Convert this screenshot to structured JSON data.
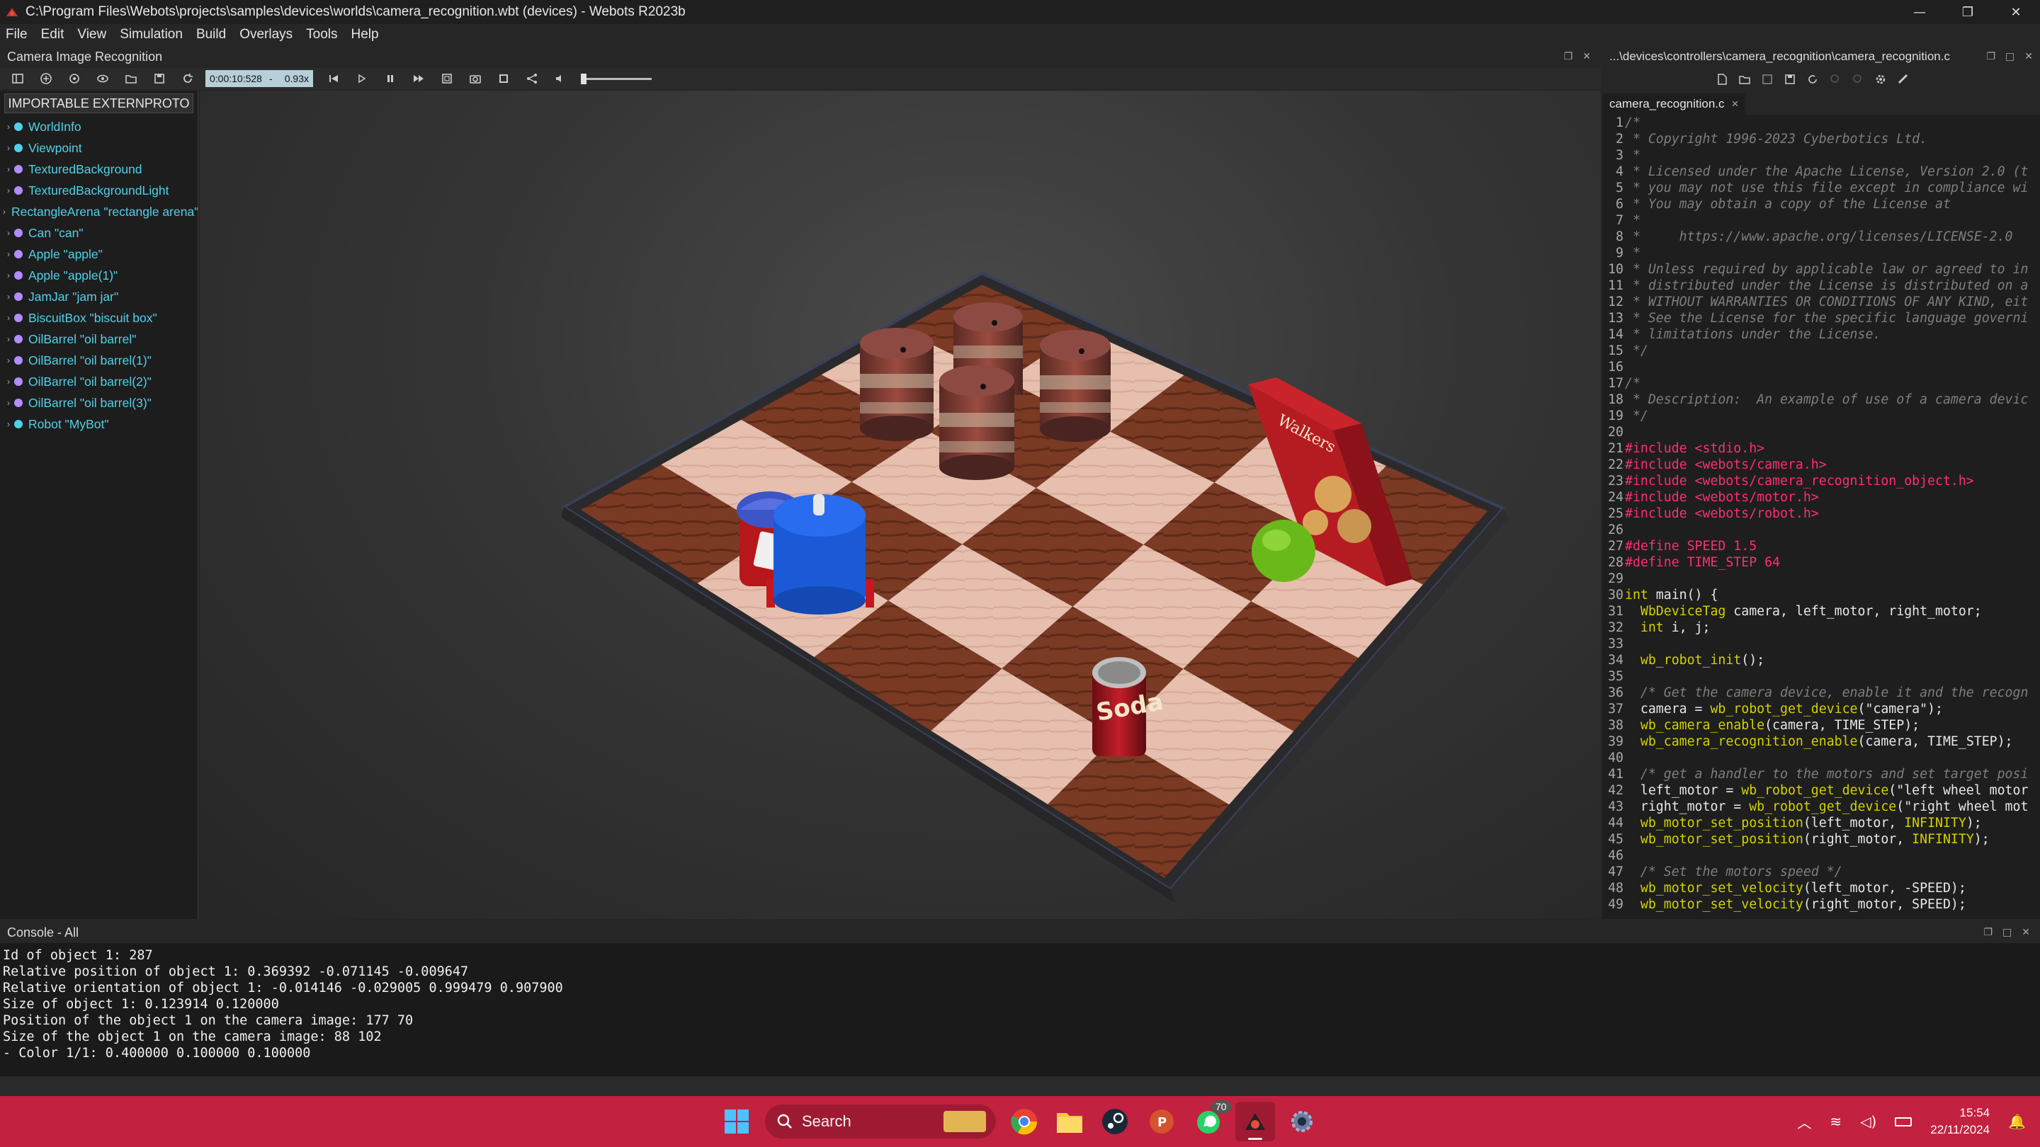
{
  "window": {
    "title": "C:\\Program Files\\Webots\\projects\\samples\\devices\\worlds\\camera_recognition.wbt (devices) - Webots R2023b",
    "minimize": "—",
    "maximize": "❐",
    "close": "✕"
  },
  "menu": [
    "File",
    "Edit",
    "View",
    "Simulation",
    "Build",
    "Overlays",
    "Tools",
    "Help"
  ],
  "view_panel": {
    "title": "Camera Image Recognition"
  },
  "toolbar": {
    "time": "0:00:10:528",
    "separator": "-",
    "speed": "0.93x"
  },
  "scene_tree": {
    "externproto_label": "IMPORTABLE EXTERNPROTO",
    "items": [
      {
        "label": "WorldInfo",
        "color": "#4fd1e8"
      },
      {
        "label": "Viewpoint",
        "color": "#4fd1e8"
      },
      {
        "label": "TexturedBackground",
        "color": "#b38cff"
      },
      {
        "label": "TexturedBackgroundLight",
        "color": "#b38cff"
      },
      {
        "label": "RectangleArena \"rectangle arena\"",
        "color": "#b38cff"
      },
      {
        "label": "Can \"can\"",
        "color": "#b38cff"
      },
      {
        "label": "Apple \"apple\"",
        "color": "#b38cff"
      },
      {
        "label": "Apple \"apple(1)\"",
        "color": "#b38cff"
      },
      {
        "label": "JamJar \"jam jar\"",
        "color": "#b38cff"
      },
      {
        "label": "BiscuitBox \"biscuit box\"",
        "color": "#b38cff"
      },
      {
        "label": "OilBarrel \"oil barrel\"",
        "color": "#b38cff"
      },
      {
        "label": "OilBarrel \"oil barrel(1)\"",
        "color": "#b38cff"
      },
      {
        "label": "OilBarrel \"oil barrel(2)\"",
        "color": "#b38cff"
      },
      {
        "label": "OilBarrel \"oil barrel(3)\"",
        "color": "#b38cff"
      },
      {
        "label": "Robot \"MyBot\"",
        "color": "#4fd1e8"
      }
    ]
  },
  "scene_labels": {
    "can_text": "Soda",
    "box_brand": "Walkers"
  },
  "editor": {
    "path": "...\\devices\\controllers\\camera_recognition\\camera_recognition.c",
    "tab": "camera_recognition.c",
    "tab_close": "×",
    "lines": [
      {
        "n": "1",
        "html": "<span class='c-comment'>/*</span>"
      },
      {
        "n": "2",
        "html": "<span class='c-comment'> * Copyright 1996-2023 Cyberbotics Ltd.</span>"
      },
      {
        "n": "3",
        "html": "<span class='c-comment'> *</span>"
      },
      {
        "n": "4",
        "html": "<span class='c-comment'> * Licensed under the Apache License, Version 2.0 (t</span>"
      },
      {
        "n": "5",
        "html": "<span class='c-comment'> * you may not use this file except in compliance wi</span>"
      },
      {
        "n": "6",
        "html": "<span class='c-comment'> * You may obtain a copy of the License at</span>"
      },
      {
        "n": "7",
        "html": "<span class='c-comment'> *</span>"
      },
      {
        "n": "8",
        "html": "<span class='c-comment'> *     https://www.apache.org/licenses/LICENSE-2.0</span>"
      },
      {
        "n": "9",
        "html": "<span class='c-comment'> *</span>"
      },
      {
        "n": "10",
        "html": "<span class='c-comment'> * Unless required by applicable law or agreed to in</span>"
      },
      {
        "n": "11",
        "html": "<span class='c-comment'> * distributed under the License is distributed on a</span>"
      },
      {
        "n": "12",
        "html": "<span class='c-comment'> * WITHOUT WARRANTIES OR CONDITIONS OF ANY KIND, eit</span>"
      },
      {
        "n": "13",
        "html": "<span class='c-comment'> * See the License for the specific language governi</span>"
      },
      {
        "n": "14",
        "html": "<span class='c-comment'> * limitations under the License.</span>"
      },
      {
        "n": "15",
        "html": "<span class='c-comment'> */</span>"
      },
      {
        "n": "16",
        "html": ""
      },
      {
        "n": "17",
        "html": "<span class='c-comment'>/*</span>"
      },
      {
        "n": "18",
        "html": "<span class='c-comment'> * Description:  An example of use of a camera devic</span>"
      },
      {
        "n": "19",
        "html": "<span class='c-comment'> */</span>"
      },
      {
        "n": "20",
        "html": ""
      },
      {
        "n": "21",
        "html": "<span class='c-pre'>#include &lt;stdio.h&gt;</span>"
      },
      {
        "n": "22",
        "html": "<span class='c-pre'>#include &lt;webots/camera.h&gt;</span>"
      },
      {
        "n": "23",
        "html": "<span class='c-pre'>#include &lt;webots/camera_recognition_object.h&gt;</span>"
      },
      {
        "n": "24",
        "html": "<span class='c-pre'>#include &lt;webots/motor.h&gt;</span>"
      },
      {
        "n": "25",
        "html": "<span class='c-pre'>#include &lt;webots/robot.h&gt;</span>"
      },
      {
        "n": "26",
        "html": ""
      },
      {
        "n": "27",
        "html": "<span class='c-pre'>#define SPEED 1.5</span>"
      },
      {
        "n": "28",
        "html": "<span class='c-pre'>#define TIME_STEP 64</span>"
      },
      {
        "n": "29",
        "html": ""
      },
      {
        "n": "30",
        "html": "<span class='c-type'>int</span><span class='c-plain'> main() {</span>"
      },
      {
        "n": "31",
        "html": "<span class='c-plain'>  </span><span class='c-type'>WbDeviceTag</span><span class='c-plain'> camera, left_motor, right_motor;</span>"
      },
      {
        "n": "32",
        "html": "<span class='c-plain'>  </span><span class='c-type'>int</span><span class='c-plain'> i, j;</span>"
      },
      {
        "n": "33",
        "html": ""
      },
      {
        "n": "34",
        "html": "<span class='c-plain'>  </span><span class='c-func'>wb_robot_init</span><span class='c-plain'>();</span>"
      },
      {
        "n": "35",
        "html": ""
      },
      {
        "n": "36",
        "html": "<span class='c-comment'>  /* Get the camera device, enable it and the recogn</span>"
      },
      {
        "n": "37",
        "html": "<span class='c-plain'>  camera = </span><span class='c-func'>wb_robot_get_device</span><span class='c-plain'>(\"camera\");</span>"
      },
      {
        "n": "38",
        "html": "<span class='c-plain'>  </span><span class='c-func'>wb_camera_enable</span><span class='c-plain'>(camera, TIME_STEP);</span>"
      },
      {
        "n": "39",
        "html": "<span class='c-plain'>  </span><span class='c-func'>wb_camera_recognition_enable</span><span class='c-plain'>(camera, TIME_STEP);</span>"
      },
      {
        "n": "40",
        "html": ""
      },
      {
        "n": "41",
        "html": "<span class='c-comment'>  /* get a handler to the motors and set target posi</span>"
      },
      {
        "n": "42",
        "html": "<span class='c-plain'>  left_motor = </span><span class='c-func'>wb_robot_get_device</span><span class='c-plain'>(\"left wheel motor</span>"
      },
      {
        "n": "43",
        "html": "<span class='c-plain'>  right_motor = </span><span class='c-func'>wb_robot_get_device</span><span class='c-plain'>(\"right wheel mot</span>"
      },
      {
        "n": "44",
        "html": "<span class='c-plain'>  </span><span class='c-func'>wb_motor_set_position</span><span class='c-plain'>(left_motor, </span><span class='c-type'>INFINITY</span><span class='c-plain'>);</span>"
      },
      {
        "n": "45",
        "html": "<span class='c-plain'>  </span><span class='c-func'>wb_motor_set_position</span><span class='c-plain'>(right_motor, </span><span class='c-type'>INFINITY</span><span class='c-plain'>);</span>"
      },
      {
        "n": "46",
        "html": ""
      },
      {
        "n": "47",
        "html": "<span class='c-comment'>  /* Set the motors speed */</span>"
      },
      {
        "n": "48",
        "html": "<span class='c-plain'>  </span><span class='c-func'>wb_motor_set_velocity</span><span class='c-plain'>(left_motor, -SPEED);</span>"
      },
      {
        "n": "49",
        "html": "<span class='c-plain'>  </span><span class='c-func'>wb_motor_set_velocity</span><span class='c-plain'>(right_motor, SPEED);</span>"
      }
    ]
  },
  "console": {
    "title": "Console - All",
    "lines": [
      "Id of object 1: 287",
      "Relative position of object 1: 0.369392 -0.071145 -0.009647",
      "Relative orientation of object 1: -0.014146 -0.029005 0.999479 0.907900",
      "Size of object 1: 0.123914 0.120000",
      "Position of the object 1 on the camera image: 177 70",
      "Size of the object 1 on the camera image: 88 102",
      "- Color 1/1: 0.400000 0.100000 0.100000"
    ]
  },
  "taskbar": {
    "search_label": "Search",
    "whatsapp_badge": "70",
    "time": "15:54",
    "date": "22/11/2024"
  }
}
